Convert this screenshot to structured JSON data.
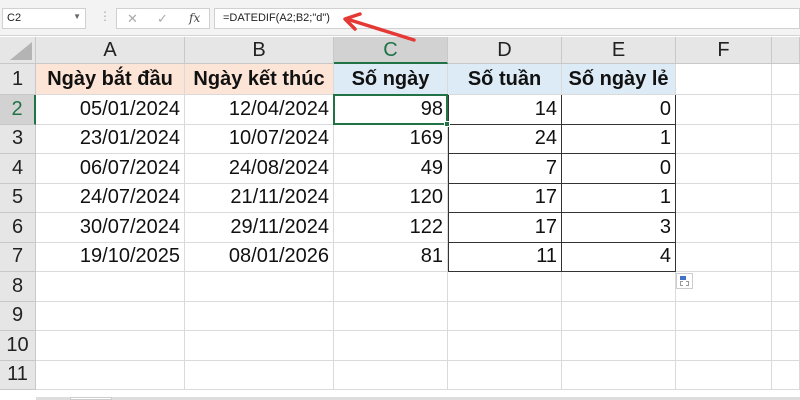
{
  "formula_bar": {
    "name_box": "C2",
    "formula": "=DATEDIF(A2;B2;\"d\")",
    "cancel_icon": "✕",
    "enter_icon": "✓",
    "fx_label": "fx"
  },
  "columns": [
    "A",
    "B",
    "C",
    "D",
    "E",
    "F"
  ],
  "rows": [
    "1",
    "2",
    "3",
    "4",
    "5",
    "6",
    "7",
    "8",
    "9",
    "10",
    "11"
  ],
  "headers": [
    "Ngày bắt đầu",
    "Ngày kết thúc",
    "Số ngày",
    "Số tuần",
    "Số ngày lẻ"
  ],
  "data": [
    [
      "05/01/2024",
      "12/04/2024",
      "98",
      "14",
      "0"
    ],
    [
      "23/01/2024",
      "10/07/2024",
      "169",
      "24",
      "1"
    ],
    [
      "06/07/2024",
      "24/08/2024",
      "49",
      "7",
      "0"
    ],
    [
      "24/07/2024",
      "21/11/2024",
      "120",
      "17",
      "1"
    ],
    [
      "30/07/2024",
      "29/11/2024",
      "122",
      "17",
      "3"
    ],
    [
      "19/10/2025",
      "08/01/2026",
      "81",
      "11",
      "4"
    ]
  ],
  "selected_cell": "C2",
  "colors": {
    "accent": "#217346",
    "peach": "#fce4d6",
    "blue": "#ddebf7",
    "arrow": "#e53935"
  }
}
